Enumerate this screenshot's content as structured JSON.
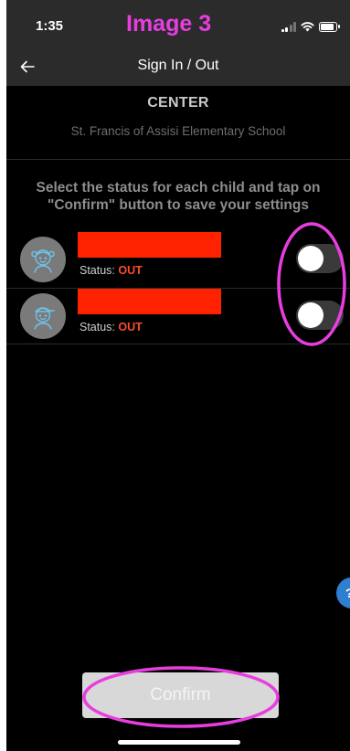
{
  "status_bar": {
    "time": "1:35",
    "overlay_label": "Image 3"
  },
  "nav": {
    "back_icon": "arrow-left-icon",
    "title": "Sign In / Out"
  },
  "center": {
    "label": "CENTER",
    "name": "St. Francis of Assisi Elementary School"
  },
  "instruction": "Select the status for each child and tap on \"Confirm\" button to save your settings",
  "children": [
    {
      "avatar_icon": "girl-avatar-icon",
      "status_label": "Status:",
      "status_value": "OUT",
      "signed_in": false
    },
    {
      "avatar_icon": "boy-avatar-icon",
      "status_label": "Status:",
      "status_value": "OUT",
      "signed_in": false
    }
  ],
  "help": {
    "label": "?"
  },
  "confirm": {
    "label": "Confirm"
  },
  "colors": {
    "background": "#000000",
    "bar": "#2b2b2b",
    "status_out": "#ff4a2e",
    "redaction": "#ff2200",
    "annotation": "#e83ee0",
    "help": "#2f7fd0",
    "confirm_bg": "#d8d8d8"
  }
}
